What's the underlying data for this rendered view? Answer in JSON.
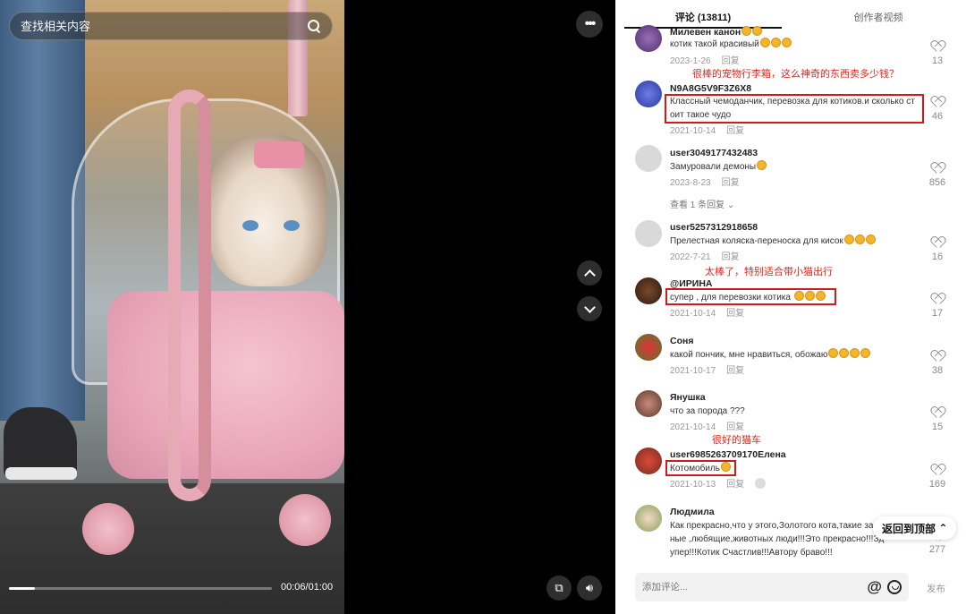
{
  "video": {
    "search_placeholder": "查找相关内容",
    "time": "00:06/01:00",
    "progress_fraction": 0.1
  },
  "tabs": [
    {
      "label": "评论 (13811)"
    },
    {
      "label": "创作者视频"
    }
  ],
  "annotations": {
    "a1": "很棒的宠物行李箱，这么神奇的东西卖多少钱？",
    "a2": "太棒了，特别适合带小猫出行",
    "a3": "很好的猫车"
  },
  "comments": [
    {
      "name": "Милевен канон",
      "text": "котик такой красивый",
      "date": "2023-1-26",
      "reply": "回复",
      "likes": "13"
    },
    {
      "name": "N9A8G5V9F3Z6X8",
      "text1": "Классный чемоданчик, перевозка для котиков.и сколько ст",
      "text2": "оит такое чудо",
      "date": "2021-10-14",
      "reply": "回复",
      "likes": "46"
    },
    {
      "name": "user3049177432483",
      "text": "Замуровали демоны",
      "date": "2023-8-23",
      "reply": "回复",
      "likes": "856",
      "replies": "查看 1 条回复"
    },
    {
      "name": "user5257312918658",
      "text": "Прелестная коляска-переноска для кисок",
      "date": "2022-7-21",
      "reply": "回复",
      "likes": "16"
    },
    {
      "name": "@ИРИНА",
      "text": "супер , для перевозки котика",
      "date": "2021-10-14",
      "reply": "回复",
      "likes": "17"
    },
    {
      "name": "Соня",
      "text": "какой пончик, мне нравиться, обожаю",
      "date": "2021-10-17",
      "reply": "回复",
      "likes": "38"
    },
    {
      "name": "Янушка",
      "text": "что за порода ???",
      "date": "2021-10-14",
      "reply": "回复",
      "likes": "15"
    },
    {
      "name": "user6985263709170Елена",
      "text": "Котомобиль",
      "date": "2021-10-13",
      "reply": "回复",
      "likes": "169"
    },
    {
      "name": "Людмила",
      "text1": "Как прекрасно,что у этого,Золотого кота,такие зам",
      "text2": "ные ,любящие,животных люди!!!Это прекрасно!!!Зд",
      "text3": "упер!!!Котик Счастлив!!!Автору браво!!!",
      "likes": "277"
    }
  ],
  "back_to_top": "返回到顶部",
  "comment_input_placeholder": "添加评论...",
  "send_label": "发布",
  "colors": {
    "annotation": "#e1251b",
    "panel_bg": "#ffffff",
    "video_bg": "#000000"
  }
}
